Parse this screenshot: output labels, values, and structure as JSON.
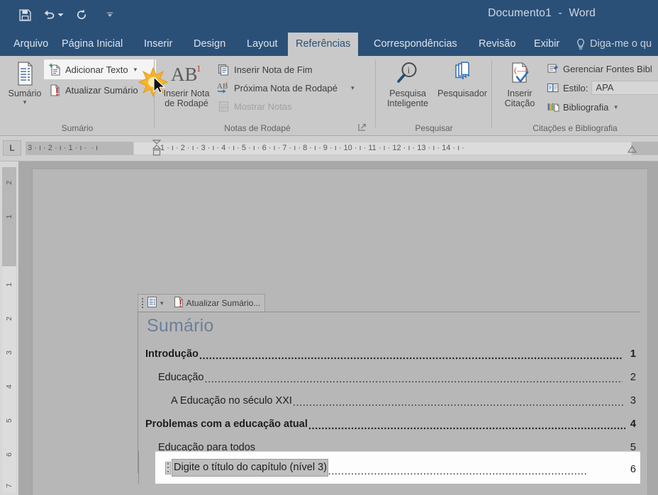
{
  "window": {
    "document_name": "Documento1",
    "separator": "-",
    "app_name": "Word"
  },
  "quick_access": {
    "items": [
      {
        "name": "save-icon",
        "label": "Salvar"
      },
      {
        "name": "undo-icon",
        "label": "Desfazer"
      },
      {
        "name": "redo-icon",
        "label": "Refazer"
      },
      {
        "name": "customize-qat-icon",
        "label": "Personalizar Barra de Ferramentas de Acesso Rápido"
      }
    ]
  },
  "tabs": [
    {
      "label": "Arquivo",
      "active": false
    },
    {
      "label": "Página Inicial",
      "active": false
    },
    {
      "label": "Inserir",
      "active": false
    },
    {
      "label": "Design",
      "active": false
    },
    {
      "label": "Layout",
      "active": false
    },
    {
      "label": "Referências",
      "active": true
    },
    {
      "label": "Correspondências",
      "active": false
    },
    {
      "label": "Revisão",
      "active": false
    },
    {
      "label": "Exibir",
      "active": false
    }
  ],
  "tell_me": {
    "label": "Diga-me o qu",
    "icon": "lightbulb-icon"
  },
  "ribbon": {
    "groups": [
      {
        "name": "sumario",
        "label": "Sumário",
        "big_button": {
          "label_line1": "Sumário",
          "icon": "toc-icon",
          "dropdown": true
        },
        "small_buttons": [
          {
            "label": "Adicionar Texto",
            "icon": "add-text-icon",
            "dropdown": true,
            "disabled": false,
            "highlighted": true
          },
          {
            "label": "Atualizar Sumário",
            "icon": "update-toc-icon",
            "dropdown": false,
            "disabled": false,
            "highlighted": false
          }
        ]
      },
      {
        "name": "notas-de-rodape",
        "label": "Notas de Rodapé",
        "big_button": {
          "label_line1": "Inserir Nota",
          "label_line2": "de Rodapé",
          "icon": "footnote-ab-icon",
          "dropdown": false
        },
        "small_buttons": [
          {
            "label": "Inserir Nota de Fim",
            "icon": "endnote-icon",
            "dropdown": false,
            "disabled": false
          },
          {
            "label": "Próxima Nota de Rodapé",
            "icon": "next-footnote-icon",
            "dropdown": true,
            "disabled": false
          },
          {
            "label": "Mostrar Notas",
            "icon": "show-notes-icon",
            "dropdown": false,
            "disabled": true
          }
        ],
        "dialog_launcher": true
      },
      {
        "name": "pesquisar",
        "label": "Pesquisar",
        "buttons": [
          {
            "label_line1": "Pesquisa",
            "label_line2": "Inteligente",
            "icon": "smart-lookup-icon"
          },
          {
            "label_line1": "Pesquisador",
            "label_line2": "",
            "icon": "researcher-icon"
          }
        ]
      },
      {
        "name": "citacoes-e-bibliografia",
        "label": "Citações e Bibliografia",
        "big_button": {
          "label_line1": "Inserir",
          "label_line2": "Citação",
          "icon": "insert-citation-icon",
          "dropdown": true
        },
        "small_buttons": [
          {
            "label": "Gerenciar Fontes Bibl",
            "icon": "manage-sources-icon",
            "dropdown": false
          },
          {
            "label": "Estilo:",
            "icon": "style-icon",
            "value": "APA",
            "is_combo": true
          },
          {
            "label": "Bibliografia",
            "icon": "bibliography-icon",
            "dropdown": true
          }
        ]
      }
    ]
  },
  "ruler": {
    "tab_stop_indicator": "L",
    "horizontal_marks_left": [
      "3",
      "2",
      "1"
    ],
    "horizontal_marks_right": [
      "1",
      "2",
      "3",
      "4",
      "5",
      "6",
      "7",
      "8",
      "9",
      "10",
      "11",
      "12",
      "13",
      "14"
    ],
    "vertical_marks": [
      "2",
      "1",
      "1",
      "2",
      "3",
      "4",
      "5",
      "6",
      "7"
    ]
  },
  "document": {
    "toc_control": {
      "toolbar_label": "Atualizar Sumário...",
      "toolbar_icon": "toc-styles-icon",
      "update_icon": "update-field-icon",
      "title": "Sumário",
      "entries": [
        {
          "text": "Introdução",
          "page": "1",
          "level": 1
        },
        {
          "text": "Educação",
          "page": "2",
          "level": 2
        },
        {
          "text": "A Educação no século XXI",
          "page": "3",
          "level": 3
        },
        {
          "text": "Problemas com a educação atual",
          "page": "4",
          "level": 1
        },
        {
          "text": "Educação para todos ",
          "page": "5",
          "level": 2
        }
      ],
      "active_entry": {
        "placeholder": "Digite o título do capítulo (nível 3)",
        "page": "6",
        "level": 3
      }
    }
  },
  "colors": {
    "titlebar": "#2b5078",
    "ribbon": "#c9c9c9",
    "active_tab_bg": "#c9c9c9",
    "heading_blue": "#6b7f99",
    "click_burst": "#f5b223"
  }
}
